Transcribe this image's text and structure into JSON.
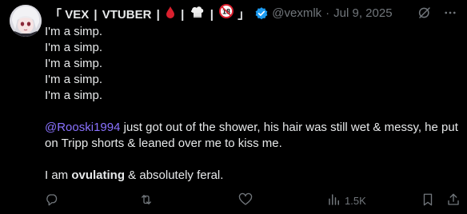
{
  "tweet": {
    "author": {
      "name_parts": [
        "「",
        "VEX",
        "|",
        "VTUBER",
        "|",
        "|",
        "|",
        "」"
      ],
      "emojis": [
        "blood-drop-icon",
        "chef-hat-icon",
        "no-one-under-18-icon"
      ],
      "handle": "@vexmlk",
      "separator": "·",
      "date": "Jul 9, 2025"
    },
    "lines": [
      "I'm a simp.",
      "I'm a simp.",
      "I'm a simp.",
      "I'm a simp.",
      "I'm a simp."
    ],
    "paragraph2": {
      "mention": "@Rooski1994",
      "text": " just got out of the shower, his hair was still wet & messy, he put on Tripp shorts & leaned over me to kiss me."
    },
    "paragraph3": {
      "before": "I am ",
      "bold": "ovulating",
      "after": " & absolutely feral."
    },
    "actions": {
      "views": "1.5K"
    },
    "colors": {
      "background": "#000000",
      "text": "#e7e9ea",
      "muted": "#71767b",
      "mention": "#8a72ff",
      "verified": "#1d9bf0"
    }
  }
}
